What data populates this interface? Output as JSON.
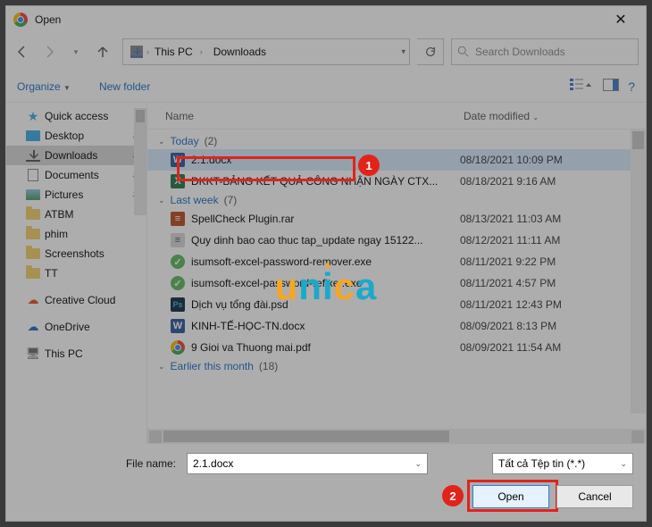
{
  "title": "Open",
  "breadcrumb": {
    "part1": "This PC",
    "part2": "Downloads"
  },
  "search": {
    "placeholder": "Search Downloads"
  },
  "toolbar": {
    "organize": "Organize",
    "new_folder": "New folder"
  },
  "columns": {
    "name": "Name",
    "date": "Date modified"
  },
  "sidebar": {
    "quick_access": "Quick access",
    "desktop": "Desktop",
    "downloads": "Downloads",
    "documents": "Documents",
    "pictures": "Pictures",
    "atbm": "ATBM",
    "phim": "phim",
    "screenshots": "Screenshots",
    "tt": "TT",
    "creative_cloud": "Creative Cloud",
    "onedrive": "OneDrive",
    "this_pc": "This PC"
  },
  "groups": {
    "today": {
      "label": "Today",
      "count": "(2)"
    },
    "last_week": {
      "label": "Last week",
      "count": "(7)"
    },
    "earlier": {
      "label": "Earlier this month",
      "count": "(18)"
    }
  },
  "files": [
    {
      "name": "2.1.docx",
      "date": "08/18/2021 10:09 PM"
    },
    {
      "name": "ĐKKT-BẢNG KẾT QUẢ CÔNG NHẬN NGÀY CTX...",
      "date": "08/18/2021 9:16 AM"
    },
    {
      "name": "SpellCheck Plugin.rar",
      "date": "08/13/2021 11:03 AM"
    },
    {
      "name": "Quy dinh bao cao thuc tap_update ngay 15122...",
      "date": "08/12/2021 11:11 AM"
    },
    {
      "name": "isumsoft-excel-password-remover.exe",
      "date": "08/11/2021 9:22 PM"
    },
    {
      "name": "isumsoft-excel-password-refixer.exe",
      "date": "08/11/2021 4:57 PM"
    },
    {
      "name": "Dịch vụ tổng đài.psd",
      "date": "08/11/2021 12:43 PM"
    },
    {
      "name": "KINH-TẾ-HỌC-TN.docx",
      "date": "08/09/2021 8:13 PM"
    },
    {
      "name": "9 Gioi va Thuong mai.pdf",
      "date": "08/09/2021 11:54 AM"
    }
  ],
  "filename": {
    "label": "File name:",
    "value": "2.1.docx"
  },
  "filetype": {
    "value": "Tất cả Tệp tin (*.*)"
  },
  "buttons": {
    "open": "Open",
    "cancel": "Cancel"
  },
  "watermark": {
    "u": "u",
    "n": "n",
    "i": "i",
    "c": "c",
    "a": "a"
  },
  "annotations": {
    "one": "1",
    "two": "2"
  }
}
